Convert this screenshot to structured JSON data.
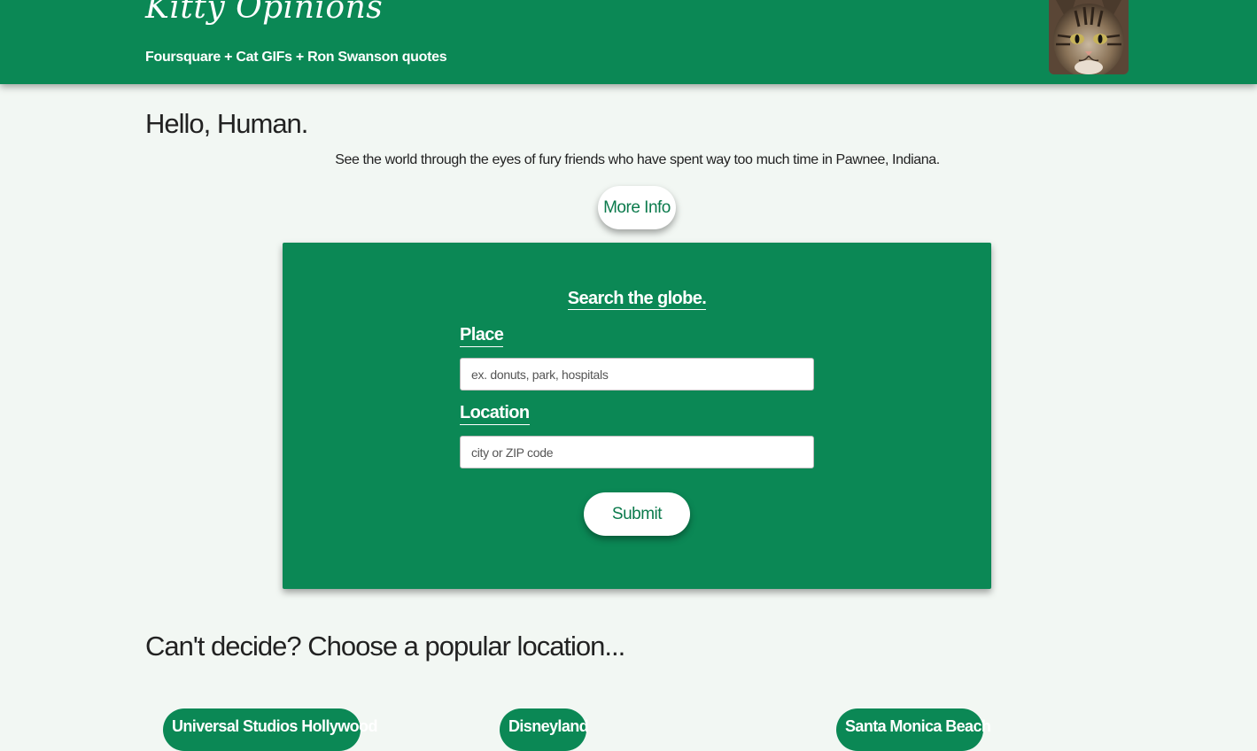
{
  "header": {
    "title": "Kitty Opinions",
    "subtitle": "Foursquare + Cat GIFs + Ron Swanson quotes",
    "avatar_icon": "cat-photo"
  },
  "intro": {
    "greeting": "Hello, Human.",
    "tagline": "See the world through the eyes of fury friends who have spent way too much time in Pawnee, Indiana.",
    "more_info_label": "More Info"
  },
  "search": {
    "heading": "Search the globe.",
    "place_label": "Place",
    "place_placeholder": "ex. donuts, park, hospitals",
    "location_label": "Location",
    "location_placeholder": "city or ZIP code",
    "submit_label": "Submit"
  },
  "popular": {
    "heading": "Can't decide? Choose a popular location...",
    "locations": [
      "Universal Studios Hollywood",
      "Disneyland",
      "Santa Monica Beach"
    ]
  },
  "colors": {
    "brand_green": "#0b8855",
    "button_text_green": "#0b7a4c",
    "page_background": "#f2f7f3"
  }
}
